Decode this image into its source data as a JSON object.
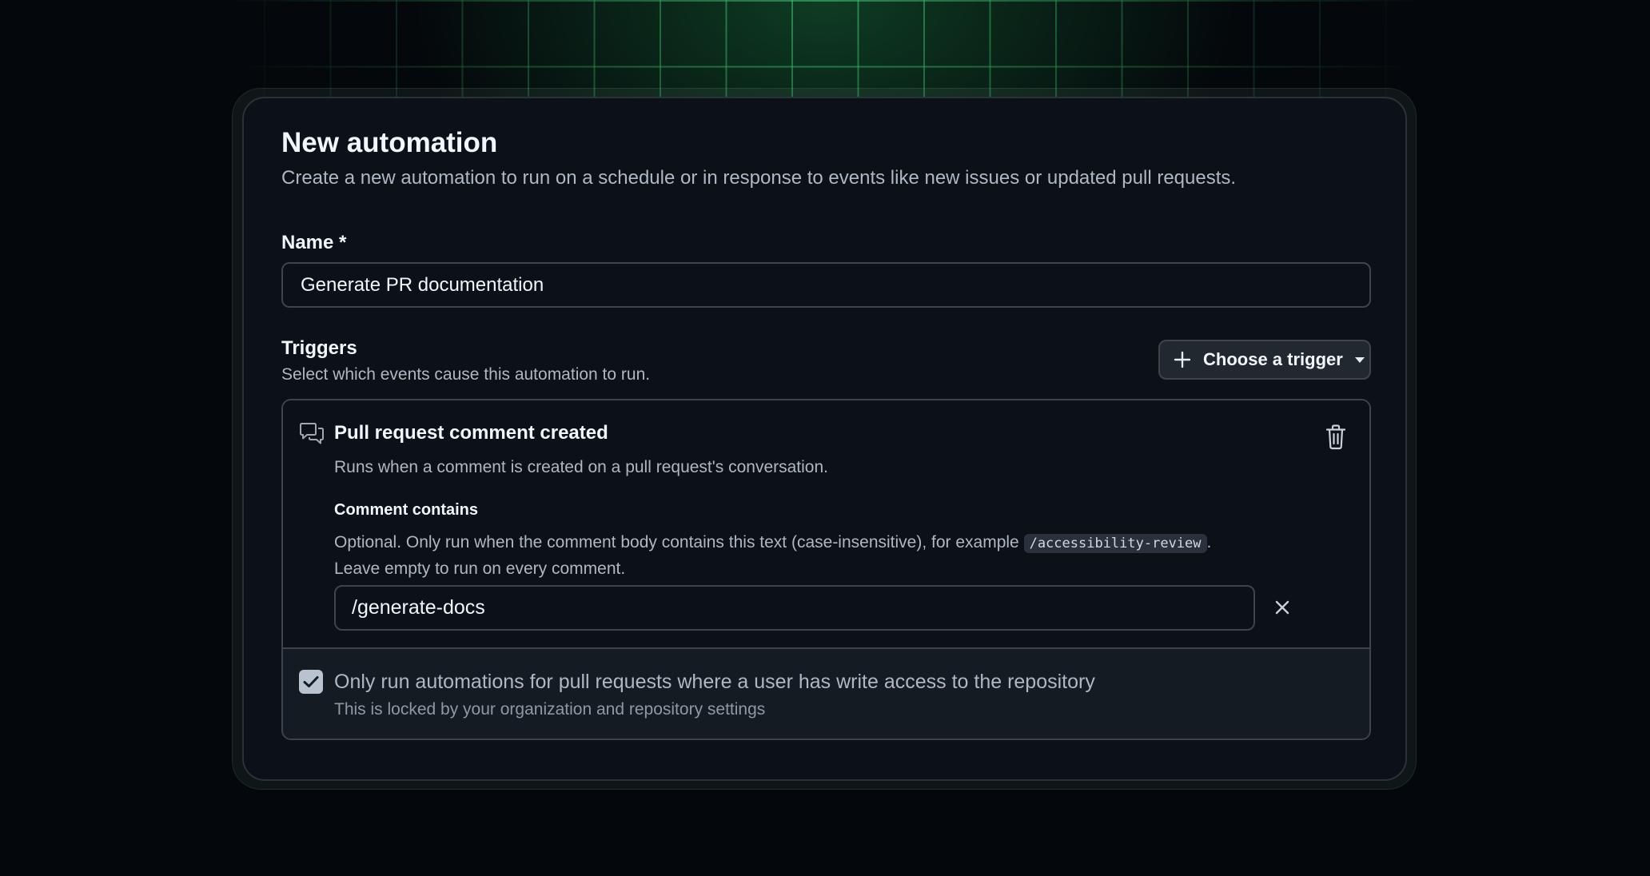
{
  "dialog": {
    "title": "New automation",
    "subtitle": "Create a new automation to run on a schedule or in response to events like new issues or updated pull requests."
  },
  "name_field": {
    "label": "Name *",
    "value": "Generate PR documentation"
  },
  "triggers": {
    "label": "Triggers",
    "description": "Select which events cause this automation to run.",
    "choose_button_label": "Choose a trigger",
    "items": [
      {
        "title": "Pull request comment created",
        "description": "Runs when a comment is created on a pull request's conversation.",
        "icon": "comment-discussion-icon",
        "comment_contains": {
          "label": "Comment contains",
          "help_before": "Optional. Only run when the comment body contains this text (case-insensitive), for example ",
          "help_code": "/accessibility-review",
          "help_after": ".",
          "help_line2": "Leave empty to run on every comment.",
          "value": "/generate-docs"
        }
      }
    ]
  },
  "write_access": {
    "checked": true,
    "label": "Only run automations for pull requests where a user has write access to the repository",
    "note": "This is locked by your organization and repository settings"
  },
  "colors": {
    "accent_green": "#4ade80",
    "panel_bg": "#0c1117",
    "border": "#3d444d"
  }
}
